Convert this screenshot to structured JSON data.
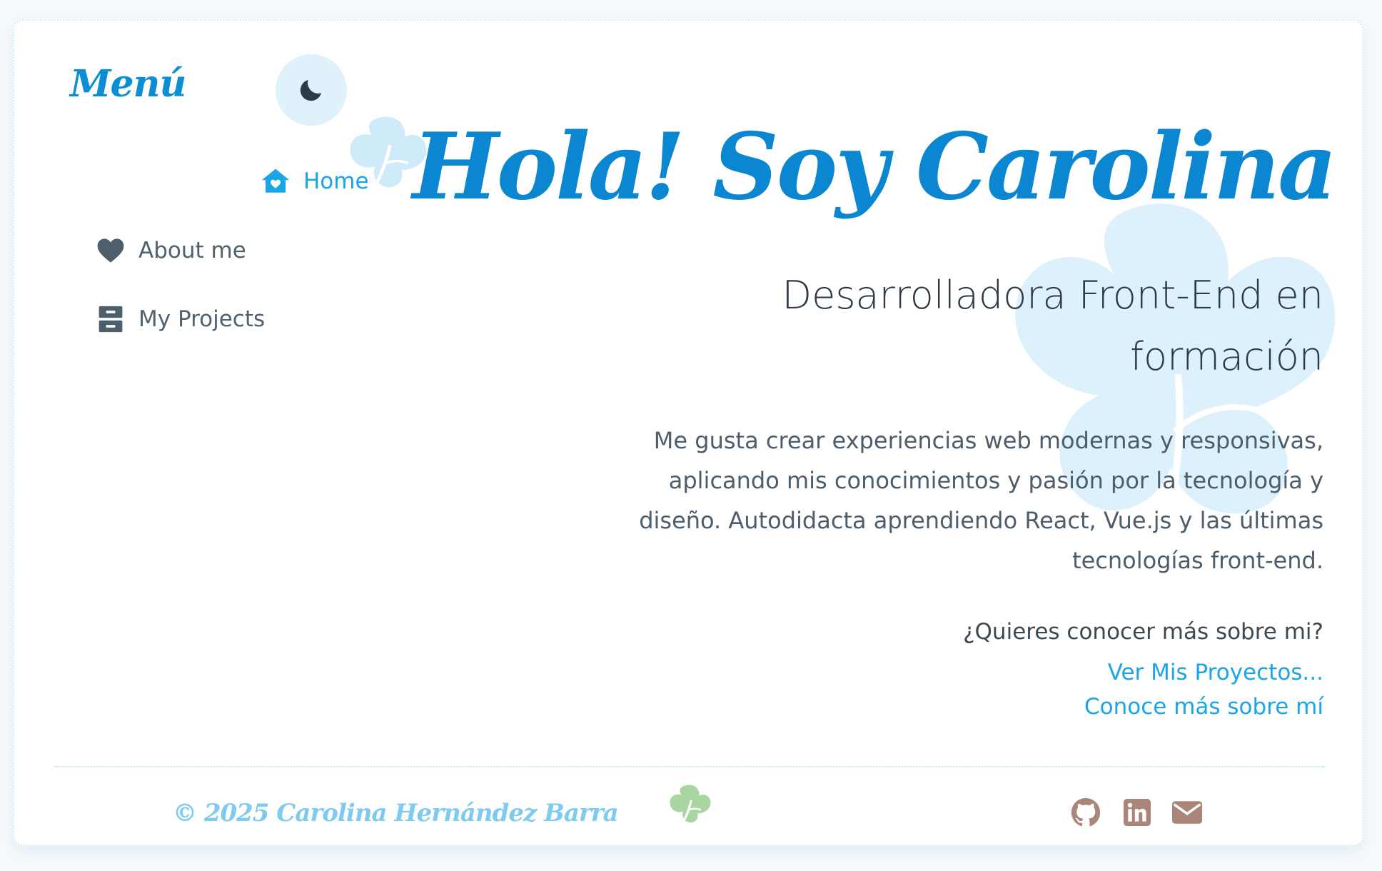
{
  "sidebar": {
    "title": "Menú",
    "items": [
      {
        "label": "Home",
        "icon": "home-icon",
        "active": true
      },
      {
        "label": "About me",
        "icon": "heart-icon",
        "active": false
      },
      {
        "label": "My Projects",
        "icon": "archive-icon",
        "active": false
      }
    ],
    "theme_toggle_icon": "moon-icon"
  },
  "hero": {
    "title": "Hola! Soy Carolina",
    "subtitle": "Desarrolladora Front-End en formación",
    "description": "Me gusta crear experiencias web modernas y responsivas, aplicando mis conocimientos y pasión por la tecnología y diseño. Autodidacta aprendiendo React, Vue.js y las últimas tecnologías front-end.",
    "question": "¿Quieres conocer más sobre mi?",
    "link_projects": "Ver Mis Proyectos...",
    "link_about": "Conoce más sobre mí"
  },
  "footer": {
    "copyright": "© 2025 Carolina Hernández Barra",
    "social": [
      "github-icon",
      "linkedin-icon",
      "mail-icon"
    ]
  },
  "colors": {
    "accent": "#1aa6e6",
    "title": "#0b86d0",
    "leaf": "#d9f0fb",
    "footer_leaf": "#a8d5a0",
    "social": "#a9857a"
  }
}
